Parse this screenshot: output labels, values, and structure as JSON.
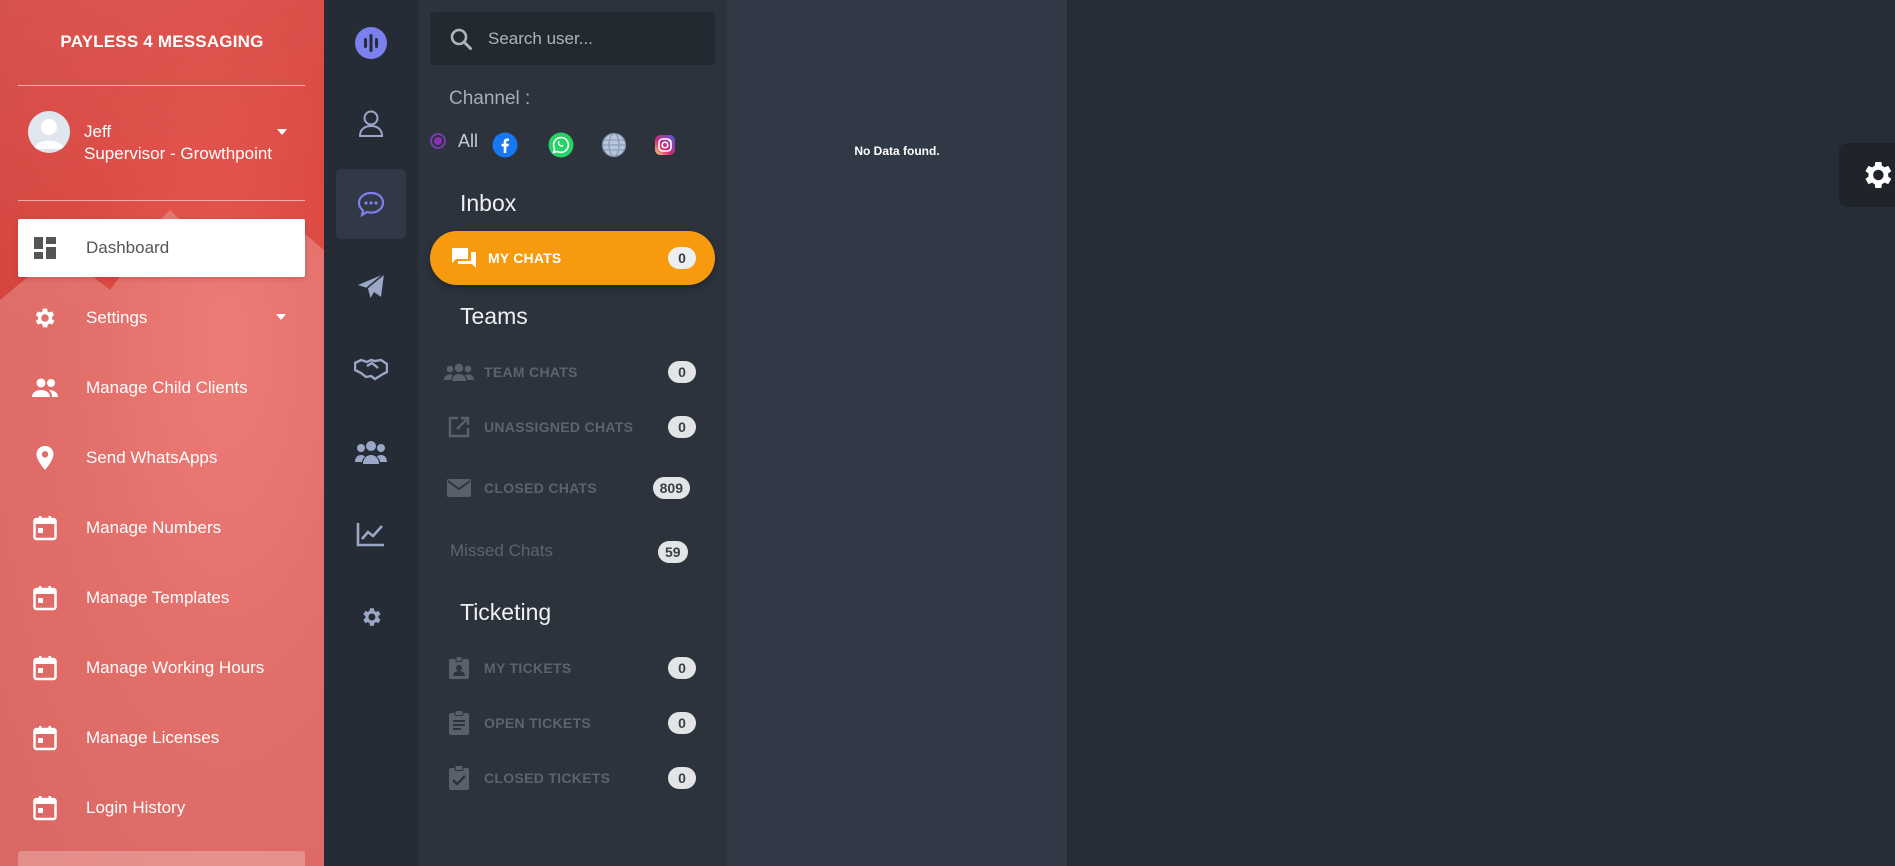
{
  "sidebar": {
    "brand": "PAYLESS 4 MESSAGING",
    "user": {
      "name": "Jeff",
      "role": "Supervisor - Growthpoint"
    },
    "items": [
      {
        "label": "Dashboard",
        "icon": "dashboard-icon",
        "active": true
      },
      {
        "label": "Settings",
        "icon": "gear-icon",
        "has_caret": true
      },
      {
        "label": "Manage Child Clients",
        "icon": "people-icon"
      },
      {
        "label": "Send WhatsApps",
        "icon": "location-pin-icon"
      },
      {
        "label": "Manage Numbers",
        "icon": "calendar-icon"
      },
      {
        "label": "Manage Templates",
        "icon": "calendar-icon"
      },
      {
        "label": "Manage Working Hours",
        "icon": "calendar-icon"
      },
      {
        "label": "Manage Licenses",
        "icon": "calendar-icon"
      },
      {
        "label": "Login History",
        "icon": "calendar-icon"
      }
    ]
  },
  "rail": {
    "items": [
      "logo-icon",
      "user-icon",
      "chat-bubble-icon",
      "paper-plane-icon",
      "handshake-icon",
      "users-group-icon",
      "chart-line-icon",
      "gear-icon"
    ],
    "active_index": 2
  },
  "panel": {
    "search_placeholder": "Search user...",
    "channel_label": "Channel :",
    "channel_all": "All",
    "channels": [
      "facebook-icon",
      "whatsapp-icon",
      "web-icon",
      "instagram-icon"
    ],
    "inbox": {
      "title": "Inbox",
      "my_chats": {
        "label": "MY CHATS",
        "count": "0"
      }
    },
    "teams": {
      "title": "Teams",
      "items": [
        {
          "label": "TEAM CHATS",
          "count": "0",
          "icon": "team-icon"
        },
        {
          "label": "UNASSIGNED CHATS",
          "count": "0",
          "icon": "external-link-icon"
        },
        {
          "label": "CLOSED CHATS",
          "count": "809",
          "icon": "envelope-icon"
        }
      ],
      "missed": {
        "label": "Missed Chats",
        "count": "59"
      }
    },
    "ticketing": {
      "title": "Ticketing",
      "items": [
        {
          "label": "MY TICKETS",
          "count": "0",
          "icon": "badge-icon"
        },
        {
          "label": "OPEN TICKETS",
          "count": "0",
          "icon": "clipboard-icon"
        },
        {
          "label": "CLOSED TICKETS",
          "count": "0",
          "icon": "clipboard-check-icon"
        }
      ]
    }
  },
  "content": {
    "empty_message": "No Data found."
  },
  "colors": {
    "sidebar_red": "#db4640",
    "accent_orange": "#f79a0e",
    "rail_accent": "#7c7fee",
    "radio_purple": "#8e2bb8"
  }
}
